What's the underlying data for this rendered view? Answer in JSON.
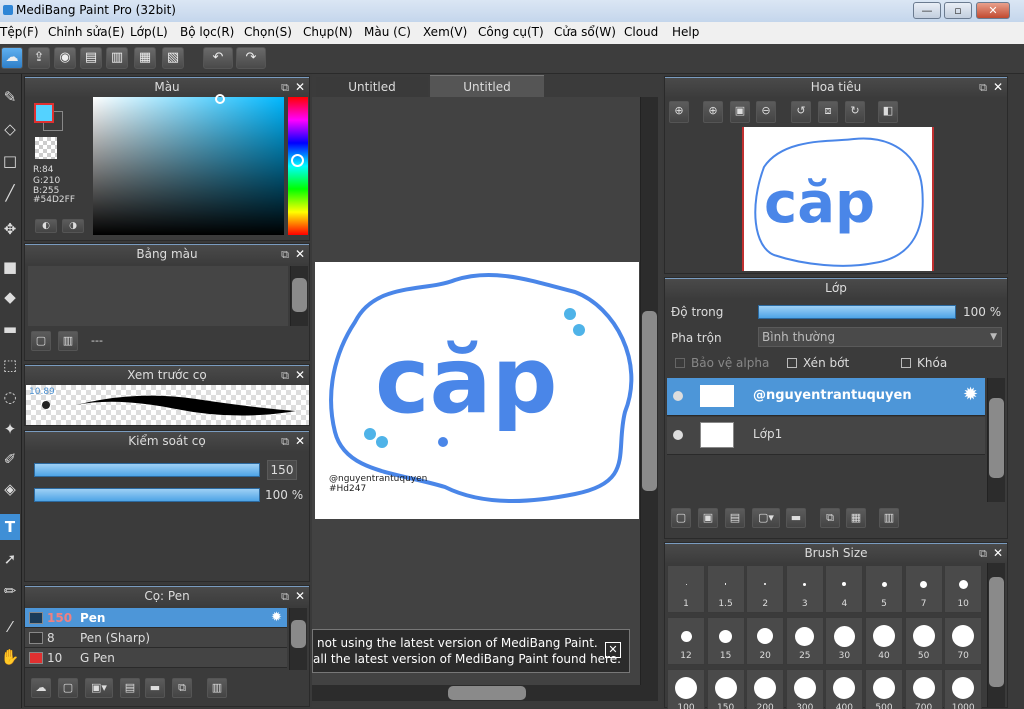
{
  "window": {
    "title": "MediBang Paint Pro (32bit)",
    "min": "—",
    "max": "▫",
    "close": "✕"
  },
  "menu": [
    "Tệp(F)",
    "Chỉnh sửa(E)",
    "Lớp(L)",
    "Bộ lọc(R)",
    "Chọn(S)",
    "Chụp(N)",
    "Màu (C)",
    "Xem(V)",
    "Công cụ(T)",
    "Cửa sổ(W)",
    "Cloud",
    "Help"
  ],
  "color_panel": {
    "title": "Màu",
    "r": "R:84",
    "g": "G:210",
    "b": "B:255",
    "hex": "#54D2FF",
    "fg": "#54d2ff",
    "bg": "#ffffff"
  },
  "palette_panel": {
    "title": "Bảng màu",
    "dash": "---"
  },
  "brush_preview": {
    "title": "Xem trước cọ",
    "size": "10.89"
  },
  "brush_control": {
    "title": "Kiểm soát cọ",
    "size_value": "150",
    "opacity_value": "100 %"
  },
  "brush_list": {
    "title": "Cọ: Pen",
    "items": [
      {
        "size": "150",
        "name": "Pen",
        "color": "#1a3b58"
      },
      {
        "size": "8",
        "name": "Pen (Sharp)",
        "color": "#333333"
      },
      {
        "size": "10",
        "name": "G Pen",
        "color": "#e03030"
      }
    ]
  },
  "tabs": [
    "Untitled",
    "Untitled"
  ],
  "canvas": {
    "art_text": "căp",
    "credit_line1": "@nguyentrantuquyen",
    "credit_line2": "#Hd247"
  },
  "notice": {
    "line1": "not using the latest version of MediBang Paint.",
    "line2": "all the latest version of MediBang Paint found here.",
    "close": "✕"
  },
  "navigator": {
    "title": "Hoa tiêu"
  },
  "layer_panel": {
    "title": "Lớp",
    "opacity_label": "Độ trong",
    "opacity_value": "100 %",
    "blend_label": "Pha trộn",
    "blend_value": "Bình thường",
    "protect_alpha": "Bảo vệ alpha",
    "clipping": "Xén bớt",
    "lock": "Khóa",
    "layers": [
      {
        "name": "@nguyentrantuquyen",
        "selected": true
      },
      {
        "name": "Lớp1",
        "selected": false
      }
    ]
  },
  "brush_size": {
    "title": "Brush Size",
    "sizes": [
      "1",
      "1.5",
      "2",
      "3",
      "4",
      "5",
      "7",
      "10",
      "12",
      "15",
      "20",
      "25",
      "30",
      "40",
      "50",
      "70",
      "100",
      "150",
      "200",
      "300",
      "400",
      "500",
      "700",
      "1000"
    ]
  }
}
